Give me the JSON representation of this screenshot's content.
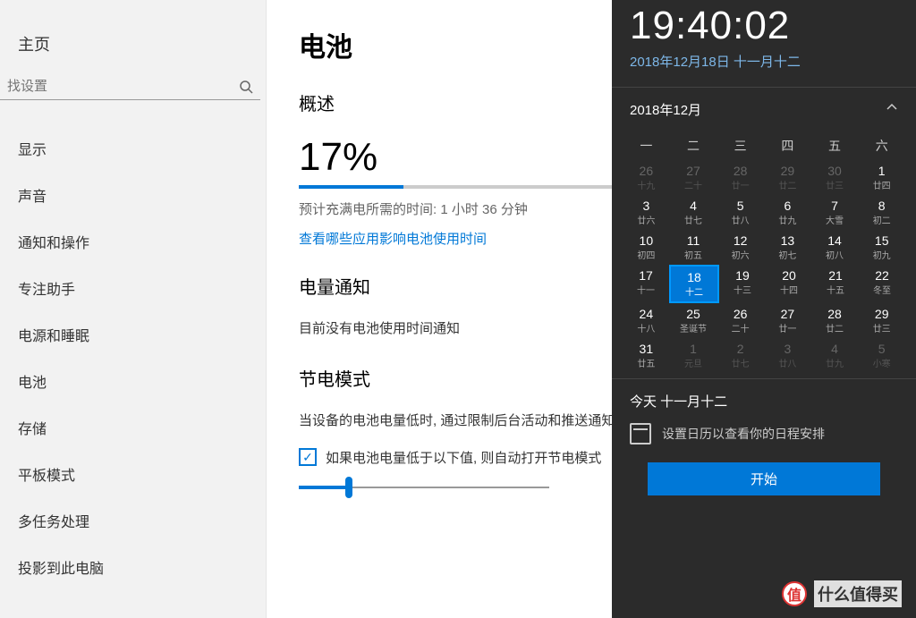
{
  "sidebar": {
    "home": "主页",
    "search_placeholder": "找设置",
    "items": [
      "显示",
      "声音",
      "通知和操作",
      "专注助手",
      "电源和睡眠",
      "电池",
      "存储",
      "平板模式",
      "多任务处理",
      "投影到此电脑"
    ]
  },
  "main": {
    "title": "电池",
    "overview_heading": "概述",
    "percent": "17%",
    "percent_value": 17,
    "estimate": "预计充满电所需的时间: 1 小时 36 分钟",
    "link": "查看哪些应用影响电池使用时间",
    "notify_heading": "电量通知",
    "notify_text": "目前没有电池使用时间通知",
    "saver_heading": "节电模式",
    "saver_desc": "当设备的电池电量低时, 通过限制后台活动和推送通知延长电池使用时间。",
    "checkbox_label": "如果电池电量低于以下值, 则自动打开节电模式",
    "slider_value": 20
  },
  "flyout": {
    "time": "19:40:02",
    "date_line": "2018年12月18日 十一月十二",
    "month_label": "2018年12月",
    "dow": [
      "一",
      "二",
      "三",
      "四",
      "五",
      "六"
    ],
    "weeks": [
      [
        {
          "d": "26",
          "s": "十九",
          "o": true
        },
        {
          "d": "27",
          "s": "二十",
          "o": true
        },
        {
          "d": "28",
          "s": "廿一",
          "o": true
        },
        {
          "d": "29",
          "s": "廿二",
          "o": true
        },
        {
          "d": "30",
          "s": "廿三",
          "o": true
        },
        {
          "d": "1",
          "s": "廿四"
        }
      ],
      [
        {
          "d": "3",
          "s": "廿六"
        },
        {
          "d": "4",
          "s": "廿七"
        },
        {
          "d": "5",
          "s": "廿八"
        },
        {
          "d": "6",
          "s": "廿九"
        },
        {
          "d": "7",
          "s": "大雪"
        },
        {
          "d": "8",
          "s": "初二"
        }
      ],
      [
        {
          "d": "10",
          "s": "初四"
        },
        {
          "d": "11",
          "s": "初五"
        },
        {
          "d": "12",
          "s": "初六"
        },
        {
          "d": "13",
          "s": "初七"
        },
        {
          "d": "14",
          "s": "初八"
        },
        {
          "d": "15",
          "s": "初九"
        }
      ],
      [
        {
          "d": "17",
          "s": "十一"
        },
        {
          "d": "18",
          "s": "十二",
          "t": true
        },
        {
          "d": "19",
          "s": "十三"
        },
        {
          "d": "20",
          "s": "十四"
        },
        {
          "d": "21",
          "s": "十五"
        },
        {
          "d": "22",
          "s": "冬至"
        }
      ],
      [
        {
          "d": "24",
          "s": "十八"
        },
        {
          "d": "25",
          "s": "圣诞节"
        },
        {
          "d": "26",
          "s": "二十"
        },
        {
          "d": "27",
          "s": "廿一"
        },
        {
          "d": "28",
          "s": "廿二"
        },
        {
          "d": "29",
          "s": "廿三"
        }
      ],
      [
        {
          "d": "31",
          "s": "廿五"
        },
        {
          "d": "1",
          "s": "元旦",
          "o": true
        },
        {
          "d": "2",
          "s": "廿七",
          "o": true
        },
        {
          "d": "3",
          "s": "廿八",
          "o": true
        },
        {
          "d": "4",
          "s": "廿九",
          "o": true
        },
        {
          "d": "5",
          "s": "小寒",
          "o": true
        }
      ]
    ],
    "agenda_title": "今天 十一月十二",
    "agenda_text": "设置日历以查看你的日程安排",
    "start_label": "开始"
  },
  "watermark": {
    "badge": "值",
    "text": "什么值得买"
  }
}
